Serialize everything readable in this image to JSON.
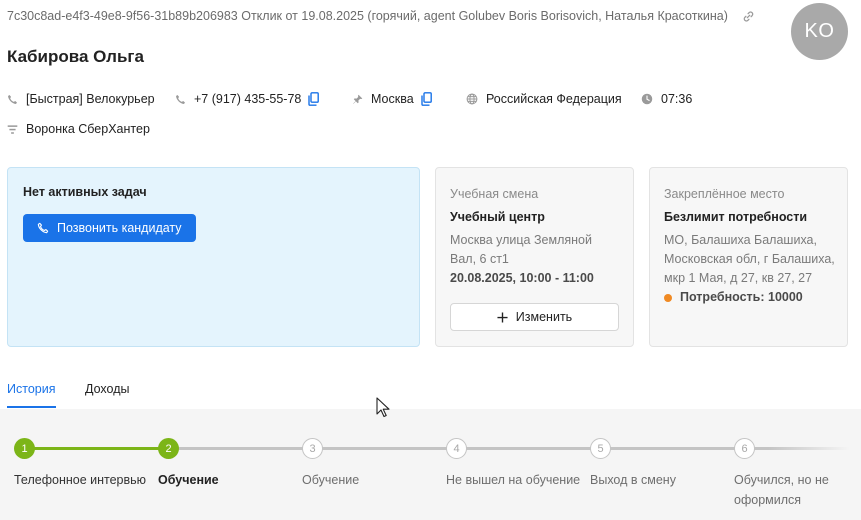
{
  "header": {
    "id_line": "7c30c8ad-e4f3-49e8-9f56-31b89b206983 Отклик от 19.08.2025 (горячий, agent Golubev Boris Borisovich, Наталья Красоткина)",
    "avatar_initials": "KO",
    "candidate_name": "Кабирова Ольга"
  },
  "meta": {
    "vacancy": "[Быстрая] Велокурьер",
    "phone": "+7 (917) 435-55-78",
    "city": "Москва",
    "country": "Российская Федерация",
    "time": "07:36",
    "funnel": "Воронка СберХантер"
  },
  "tasks": {
    "title": "Нет активных задач",
    "call_button": "Позвонить кандидату"
  },
  "shift": {
    "caption": "Учебная смена",
    "title": "Учебный центр",
    "address": "Москва улица Земляной Вал, 6 ст1",
    "datetime": "20.08.2025, 10:00 - 11:00",
    "change_button": "Изменить"
  },
  "place": {
    "caption": "Закреплённое место",
    "title": "Безлимит потребности",
    "address": "МО, Балашиха Балашиха, Московская обл, г Балашиха, мкр 1 Мая, д 27, кв 27, 27",
    "need": "Потребность: 10000"
  },
  "tabs": {
    "history": "История",
    "income": "Доходы"
  },
  "steps": [
    {
      "num": "1",
      "label": "Телефонное интервью",
      "state": "done"
    },
    {
      "num": "2",
      "label": "Обучение",
      "state": "current"
    },
    {
      "num": "3",
      "label": "Обучение",
      "state": "todo"
    },
    {
      "num": "4",
      "label": "Не вышел на обучение",
      "state": "todo"
    },
    {
      "num": "5",
      "label": "Выход в смену",
      "state": "todo"
    },
    {
      "num": "6",
      "label": "Обучился, но не оформился",
      "state": "todo"
    }
  ],
  "colors": {
    "accent": "#1a73e8",
    "progress_done": "#7cb518",
    "progress_todo": "#c4c4c4",
    "need_dot": "#f08a24",
    "tasks_bg": "#e4f4fd"
  }
}
